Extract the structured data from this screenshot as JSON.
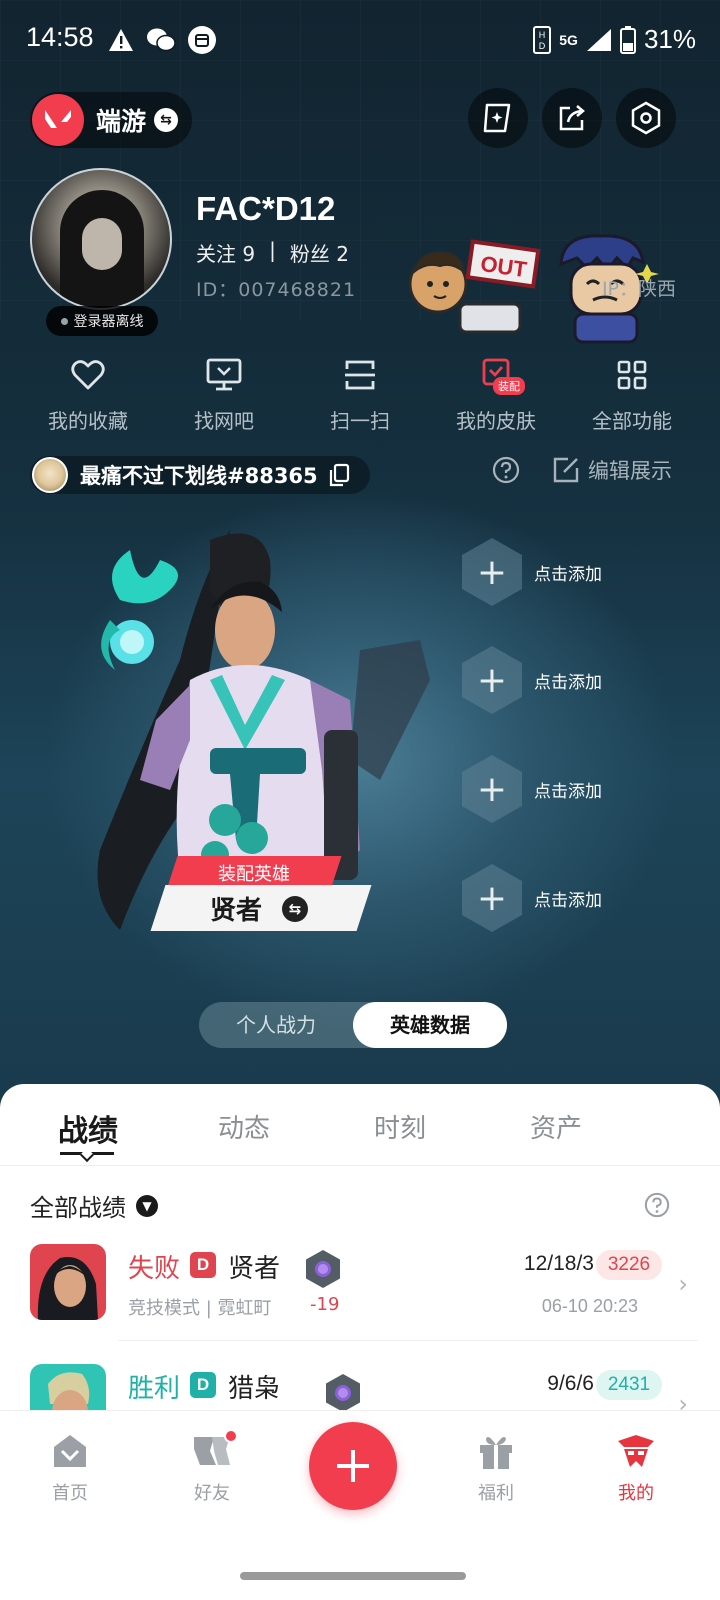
{
  "status_bar": {
    "time": "14:58",
    "network": "5G",
    "battery": "31%"
  },
  "header": {
    "mode_label": "端游",
    "swap_glyph": "⇆",
    "icons": [
      "edit-card-icon",
      "share-icon",
      "settings-hex-icon"
    ]
  },
  "profile": {
    "username": "FAC*D12",
    "follow_label": "关注 9",
    "separator": "|",
    "fans_label": "粉丝 2",
    "id_text": "ID：007468821",
    "ip_text": "IP：陕西",
    "offline_text": "登录器离线",
    "sticker_text": "OUT"
  },
  "quick_actions": [
    {
      "label": "我的收藏",
      "icon": "heart-icon"
    },
    {
      "label": "找网吧",
      "icon": "monitor-icon"
    },
    {
      "label": "扫一扫",
      "icon": "scan-icon"
    },
    {
      "label": "我的皮肤",
      "icon": "skin-icon",
      "badge": "装配"
    },
    {
      "label": "全部功能",
      "icon": "grid-icon"
    }
  ],
  "title_bar": {
    "title": "最痛不过下划线#88365",
    "edit_label": "编辑展示"
  },
  "hero": {
    "tag": "装配英雄",
    "name": "贤者"
  },
  "slots": [
    {
      "label": "点击添加"
    },
    {
      "label": "点击添加"
    },
    {
      "label": "点击添加"
    },
    {
      "label": "点击添加"
    }
  ],
  "toggle": {
    "options": [
      "个人战力",
      "英雄数据"
    ],
    "active": "英雄数据"
  },
  "tabs": [
    "战绩",
    "动态",
    "时刻",
    "资产"
  ],
  "filter": {
    "label": "全部战绩"
  },
  "matches": [
    {
      "result": "失败",
      "result_color": "#e0454f",
      "badge": "D",
      "badge_color": "#e0454f",
      "hero": "贤者",
      "meta": "竞技模式 | 霓虹町",
      "rank_delta": "-19",
      "kda": "12/18/3",
      "score": "3226",
      "score_bg": "#fde6e6",
      "score_color": "#e0454f",
      "time": "06-10 20:23"
    },
    {
      "result": "胜利",
      "result_color": "#1fb1a8",
      "badge": "D",
      "badge_color": "#1fb1a8",
      "hero": "猎枭",
      "meta": "",
      "rank_delta": "",
      "kda": "9/6/6",
      "score": "2431",
      "score_bg": "#dff5f2",
      "score_color": "#1fb1a8",
      "time": ""
    }
  ],
  "bottom_nav": [
    {
      "label": "首页",
      "icon": "home-icon"
    },
    {
      "label": "好友",
      "icon": "friends-icon"
    },
    {
      "label": "福利",
      "icon": "gift-icon"
    },
    {
      "label": "我的",
      "icon": "me-icon",
      "active": true
    }
  ],
  "colors": {
    "brand_red": "#f23d4f",
    "win_teal": "#1fb1a8",
    "loss_red": "#e0454f"
  }
}
